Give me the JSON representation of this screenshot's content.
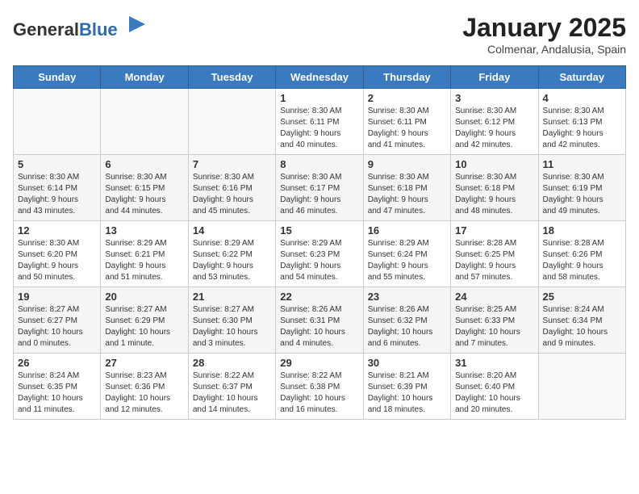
{
  "header": {
    "logo_general": "General",
    "logo_blue": "Blue",
    "month_title": "January 2025",
    "location": "Colmenar, Andalusia, Spain"
  },
  "days_of_week": [
    "Sunday",
    "Monday",
    "Tuesday",
    "Wednesday",
    "Thursday",
    "Friday",
    "Saturday"
  ],
  "weeks": [
    [
      {
        "day": "",
        "info": ""
      },
      {
        "day": "",
        "info": ""
      },
      {
        "day": "",
        "info": ""
      },
      {
        "day": "1",
        "info": "Sunrise: 8:30 AM\nSunset: 6:11 PM\nDaylight: 9 hours\nand 40 minutes."
      },
      {
        "day": "2",
        "info": "Sunrise: 8:30 AM\nSunset: 6:11 PM\nDaylight: 9 hours\nand 41 minutes."
      },
      {
        "day": "3",
        "info": "Sunrise: 8:30 AM\nSunset: 6:12 PM\nDaylight: 9 hours\nand 42 minutes."
      },
      {
        "day": "4",
        "info": "Sunrise: 8:30 AM\nSunset: 6:13 PM\nDaylight: 9 hours\nand 42 minutes."
      }
    ],
    [
      {
        "day": "5",
        "info": "Sunrise: 8:30 AM\nSunset: 6:14 PM\nDaylight: 9 hours\nand 43 minutes."
      },
      {
        "day": "6",
        "info": "Sunrise: 8:30 AM\nSunset: 6:15 PM\nDaylight: 9 hours\nand 44 minutes."
      },
      {
        "day": "7",
        "info": "Sunrise: 8:30 AM\nSunset: 6:16 PM\nDaylight: 9 hours\nand 45 minutes."
      },
      {
        "day": "8",
        "info": "Sunrise: 8:30 AM\nSunset: 6:17 PM\nDaylight: 9 hours\nand 46 minutes."
      },
      {
        "day": "9",
        "info": "Sunrise: 8:30 AM\nSunset: 6:18 PM\nDaylight: 9 hours\nand 47 minutes."
      },
      {
        "day": "10",
        "info": "Sunrise: 8:30 AM\nSunset: 6:18 PM\nDaylight: 9 hours\nand 48 minutes."
      },
      {
        "day": "11",
        "info": "Sunrise: 8:30 AM\nSunset: 6:19 PM\nDaylight: 9 hours\nand 49 minutes."
      }
    ],
    [
      {
        "day": "12",
        "info": "Sunrise: 8:30 AM\nSunset: 6:20 PM\nDaylight: 9 hours\nand 50 minutes."
      },
      {
        "day": "13",
        "info": "Sunrise: 8:29 AM\nSunset: 6:21 PM\nDaylight: 9 hours\nand 51 minutes."
      },
      {
        "day": "14",
        "info": "Sunrise: 8:29 AM\nSunset: 6:22 PM\nDaylight: 9 hours\nand 53 minutes."
      },
      {
        "day": "15",
        "info": "Sunrise: 8:29 AM\nSunset: 6:23 PM\nDaylight: 9 hours\nand 54 minutes."
      },
      {
        "day": "16",
        "info": "Sunrise: 8:29 AM\nSunset: 6:24 PM\nDaylight: 9 hours\nand 55 minutes."
      },
      {
        "day": "17",
        "info": "Sunrise: 8:28 AM\nSunset: 6:25 PM\nDaylight: 9 hours\nand 57 minutes."
      },
      {
        "day": "18",
        "info": "Sunrise: 8:28 AM\nSunset: 6:26 PM\nDaylight: 9 hours\nand 58 minutes."
      }
    ],
    [
      {
        "day": "19",
        "info": "Sunrise: 8:27 AM\nSunset: 6:27 PM\nDaylight: 10 hours\nand 0 minutes."
      },
      {
        "day": "20",
        "info": "Sunrise: 8:27 AM\nSunset: 6:29 PM\nDaylight: 10 hours\nand 1 minute."
      },
      {
        "day": "21",
        "info": "Sunrise: 8:27 AM\nSunset: 6:30 PM\nDaylight: 10 hours\nand 3 minutes."
      },
      {
        "day": "22",
        "info": "Sunrise: 8:26 AM\nSunset: 6:31 PM\nDaylight: 10 hours\nand 4 minutes."
      },
      {
        "day": "23",
        "info": "Sunrise: 8:26 AM\nSunset: 6:32 PM\nDaylight: 10 hours\nand 6 minutes."
      },
      {
        "day": "24",
        "info": "Sunrise: 8:25 AM\nSunset: 6:33 PM\nDaylight: 10 hours\nand 7 minutes."
      },
      {
        "day": "25",
        "info": "Sunrise: 8:24 AM\nSunset: 6:34 PM\nDaylight: 10 hours\nand 9 minutes."
      }
    ],
    [
      {
        "day": "26",
        "info": "Sunrise: 8:24 AM\nSunset: 6:35 PM\nDaylight: 10 hours\nand 11 minutes."
      },
      {
        "day": "27",
        "info": "Sunrise: 8:23 AM\nSunset: 6:36 PM\nDaylight: 10 hours\nand 12 minutes."
      },
      {
        "day": "28",
        "info": "Sunrise: 8:22 AM\nSunset: 6:37 PM\nDaylight: 10 hours\nand 14 minutes."
      },
      {
        "day": "29",
        "info": "Sunrise: 8:22 AM\nSunset: 6:38 PM\nDaylight: 10 hours\nand 16 minutes."
      },
      {
        "day": "30",
        "info": "Sunrise: 8:21 AM\nSunset: 6:39 PM\nDaylight: 10 hours\nand 18 minutes."
      },
      {
        "day": "31",
        "info": "Sunrise: 8:20 AM\nSunset: 6:40 PM\nDaylight: 10 hours\nand 20 minutes."
      },
      {
        "day": "",
        "info": ""
      }
    ]
  ]
}
